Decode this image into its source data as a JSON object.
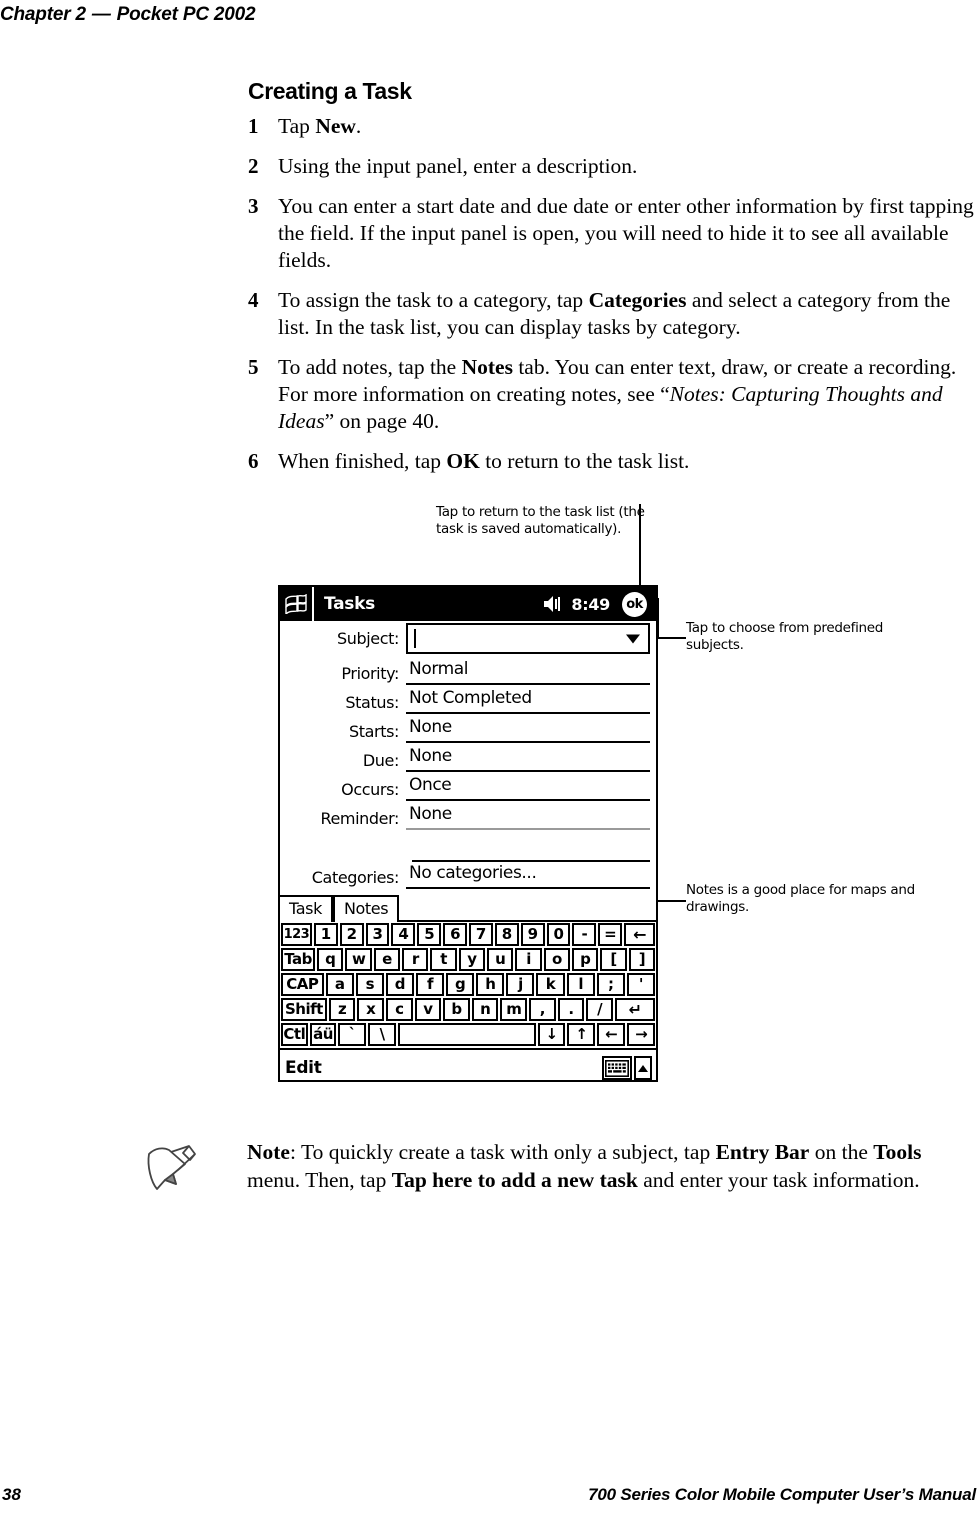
{
  "header": {
    "chapter": "Chapter 2",
    "separator": "—",
    "chapter_title": "Pocket PC 2002"
  },
  "section": {
    "title": "Creating a Task"
  },
  "steps": [
    {
      "num": "1",
      "text_html": "Tap <b>New</b>."
    },
    {
      "num": "2",
      "text_html": "Using the input panel, enter a description."
    },
    {
      "num": "3",
      "text_html": "You can enter a start date and due date or enter other information by first tapping the field. If the input panel is open, you will need to hide it to see all available fields."
    },
    {
      "num": "4",
      "text_html": "To assign the task to a category, tap <b>Categories</b> and select a category from the list. In the task list, you can display tasks by category."
    },
    {
      "num": "5",
      "text_html": "To add notes, tap the <b>Notes</b> tab. You can enter text, draw, or create a recording. For more information on creating notes, see &ldquo;<i>Notes: Capturing Thoughts and Ideas</i>&rdquo; on page 40."
    },
    {
      "num": "6",
      "text_html": "When finished, tap <b>OK</b> to return to the task list."
    }
  ],
  "figure": {
    "callouts": {
      "top": "Tap to return to the task list (the task is saved automatically).",
      "right_subject": "Tap to choose from predefined subjects.",
      "right_notes": "Notes is a good place for maps and drawings."
    },
    "device": {
      "titlebar": {
        "start_icon": "windows-flag-icon",
        "title": "Tasks",
        "speaker_icon": "speaker-icon",
        "time": "8:49",
        "ok_label": "ok"
      },
      "fields": [
        {
          "label": "Subject:",
          "value": "",
          "type": "combo"
        },
        {
          "label": "Priority:",
          "value": "Normal",
          "type": "text"
        },
        {
          "label": "Status:",
          "value": "Not Completed",
          "type": "text"
        },
        {
          "label": "Starts:",
          "value": "None",
          "type": "text"
        },
        {
          "label": "Due:",
          "value": "None",
          "type": "text"
        },
        {
          "label": "Occurs:",
          "value": "Once",
          "type": "text"
        },
        {
          "label": "Reminder:",
          "value": "None",
          "type": "text"
        },
        {
          "label": "Categories:",
          "value": "No categories...",
          "type": "text"
        }
      ],
      "tabs": [
        {
          "label": "Task",
          "selected": true
        },
        {
          "label": "Notes",
          "selected": false
        }
      ],
      "keyboard": {
        "rows": [
          [
            "123",
            "1",
            "2",
            "3",
            "4",
            "5",
            "6",
            "7",
            "8",
            "9",
            "0",
            "-",
            "=",
            "←"
          ],
          [
            "Tab",
            "q",
            "w",
            "e",
            "r",
            "t",
            "y",
            "u",
            "i",
            "o",
            "p",
            "[",
            "]"
          ],
          [
            "CAP",
            "a",
            "s",
            "d",
            "f",
            "g",
            "h",
            "j",
            "k",
            "l",
            ";",
            "'"
          ],
          [
            "Shift",
            "z",
            "x",
            "c",
            "v",
            "b",
            "n",
            "m",
            ",",
            ".",
            "/",
            "↵"
          ],
          [
            "Ctl",
            "áü",
            "`",
            "\\",
            "",
            "↓",
            "↑",
            "←",
            "→"
          ]
        ]
      },
      "bottom_bar": {
        "menu_label": "Edit",
        "keyboard_icon": "keyboard-icon",
        "up_icon": "chevron-up-icon"
      }
    }
  },
  "note": {
    "icon": "note-pencil-icon",
    "text_html": "<b>Note</b>: To quickly create a task with only a subject, tap <b>Entry Bar</b> on the <b>Tools</b> menu. Then, tap <b>Tap here to add a new task</b> and enter your task information."
  },
  "footer": {
    "page_number": "38",
    "manual_title": "700 Series Color Mobile Computer User’s Manual"
  }
}
